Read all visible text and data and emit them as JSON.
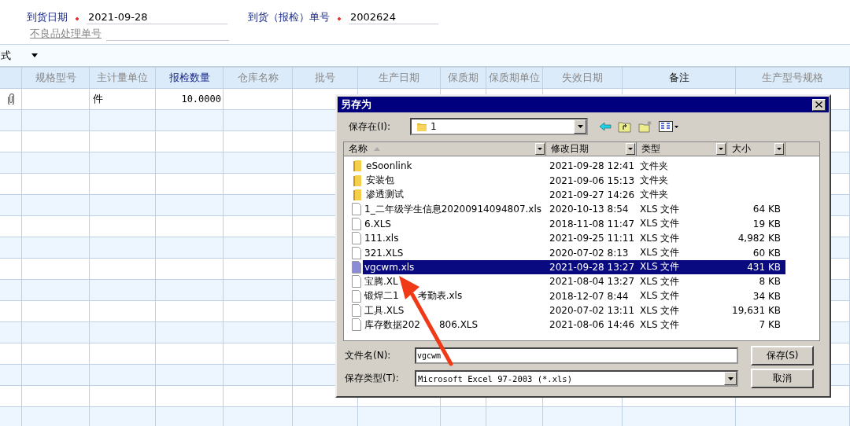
{
  "form": {
    "rows": [
      [
        {
          "label": "到货日期",
          "kind": "required",
          "value": "2021-09-28"
        },
        {
          "label": "到货（报检）单号",
          "kind": "required",
          "value": "2002624"
        }
      ],
      [
        {
          "label": "不良品处理单号",
          "kind": "link"
        }
      ]
    ]
  },
  "toolbar": {
    "label": "式"
  },
  "table": {
    "columns": [
      {
        "kind": "icon"
      },
      {
        "label": "规格型号",
        "kind": "normal"
      },
      {
        "label": "主计量单位",
        "kind": "normal"
      },
      {
        "label": "报检数量",
        "kind": "key"
      },
      {
        "label": "仓库名称",
        "kind": "normal"
      },
      {
        "label": "批号",
        "kind": "normal"
      },
      {
        "label": "生产日期",
        "kind": "normal"
      },
      {
        "label": "保质期",
        "kind": "normal"
      },
      {
        "label": "保质期单位",
        "kind": "normal"
      },
      {
        "label": "失效日期",
        "kind": "normal"
      },
      {
        "label": "备注",
        "kind": "dark"
      },
      {
        "label": "生产型号规格",
        "kind": "normal"
      }
    ],
    "rows": [
      {
        "attachment": true,
        "unit": "件",
        "quantity": "10.0000"
      }
    ]
  },
  "dialog": {
    "title": "另存为",
    "location": {
      "label": "保存在(I):",
      "value": "1"
    },
    "columns": [
      {
        "label": "名称",
        "sorted": true
      },
      {
        "label": "修改日期",
        "sorted": false
      },
      {
        "label": "类型",
        "sorted": false
      },
      {
        "label": "大小",
        "sorted": false
      }
    ],
    "files": [
      {
        "kind": "folder",
        "name": "eSoonlink",
        "modified": "2021-09-28 12:41",
        "type": "文件夹",
        "selected": false
      },
      {
        "kind": "folder",
        "name": "安装包",
        "modified": "2021-09-06 15:13",
        "type": "文件夹",
        "selected": false
      },
      {
        "kind": "folder",
        "name": "渗透测试",
        "modified": "2021-09-27 14:26",
        "type": "文件夹",
        "selected": false
      },
      {
        "kind": "file",
        "name": "1_二年级学生信息20200914094807.xls",
        "modified": "2020-10-13 8:54",
        "type": "XLS 文件",
        "size": "64 KB",
        "selected": false
      },
      {
        "kind": "file",
        "name": "6.XLS",
        "modified": "2018-11-08 11:47",
        "type": "XLS 文件",
        "size": "19 KB",
        "selected": false
      },
      {
        "kind": "file",
        "name": "111.xls",
        "modified": "2021-09-25 11:11",
        "type": "XLS 文件",
        "size": "4,982 KB",
        "selected": false
      },
      {
        "kind": "file",
        "name": "321.XLS",
        "modified": "2020-07-02 8:13",
        "type": "XLS 文件",
        "size": "60 KB",
        "selected": false
      },
      {
        "kind": "file",
        "name": "vgcwm.xls",
        "modified": "2021-09-28 13:27",
        "type": "XLS 文件",
        "size": "431 KB",
        "selected": true
      },
      {
        "kind": "file",
        "name": "宝腾.XL",
        "modified": "2021-08-04 13:27",
        "type": "XLS 文件",
        "size": "8 KB",
        "selected": false
      },
      {
        "kind": "file",
        "name_parts": [
          "锻焊二1",
          "考勤表.xls"
        ],
        "modified": "2018-12-07 8:44",
        "type": "XLS 文件",
        "size": "34 KB",
        "selected": false
      },
      {
        "kind": "file",
        "name": "工具.XLS",
        "modified": "2020-07-02 13:11",
        "type": "XLS 文件",
        "size": "19,631 KB",
        "selected": false
      },
      {
        "kind": "file",
        "name_parts": [
          "库存数据202",
          "806.XLS"
        ],
        "modified": "2021-08-06 14:46",
        "type": "XLS 文件",
        "size": "7 KB",
        "selected": false
      }
    ],
    "filename": {
      "label": "文件名(N):",
      "value": "vgcwm"
    },
    "filetype": {
      "label": "保存类型(T):",
      "value": "Microsoft Excel 97-2003 (*.xls)"
    },
    "buttons": [
      "保存(S)",
      "取消"
    ]
  }
}
